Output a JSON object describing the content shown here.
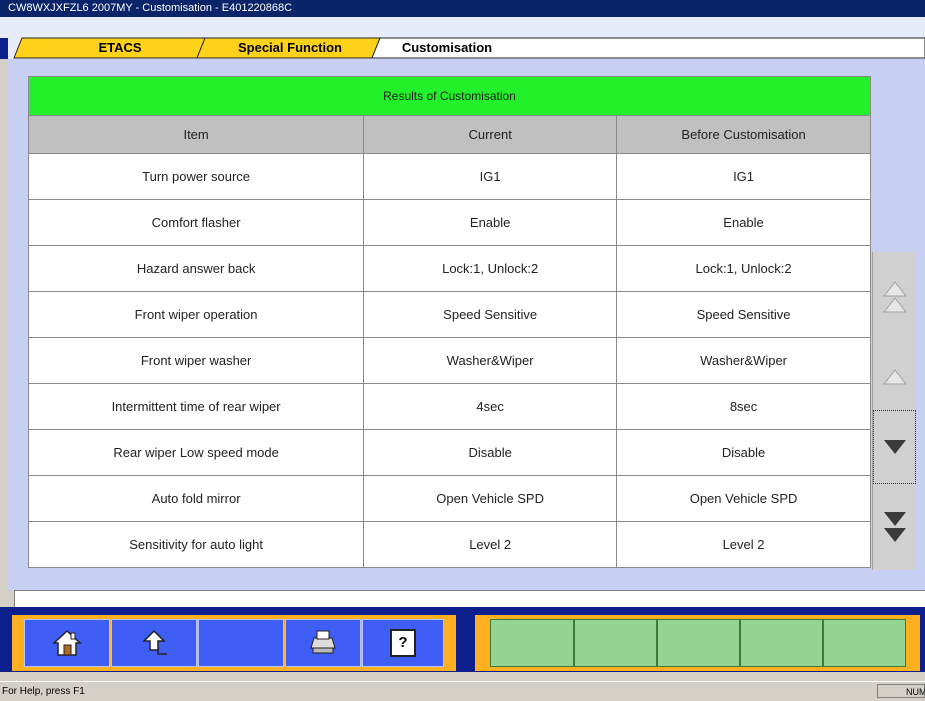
{
  "window": {
    "title": "CW8WXJXFZL6 2007MY   -  Customisation  -  E401220868C"
  },
  "tabs": [
    {
      "label": "ETACS"
    },
    {
      "label": "Special Function"
    },
    {
      "label": "Customisation"
    }
  ],
  "table": {
    "caption": "Results of Customisation",
    "columns": [
      "Item",
      "Current",
      "Before Customisation"
    ],
    "rows": [
      [
        "Turn power source",
        "IG1",
        "IG1"
      ],
      [
        "Comfort flasher",
        "Enable",
        "Enable"
      ],
      [
        "Hazard answer back",
        "Lock:1, Unlock:2",
        "Lock:1, Unlock:2"
      ],
      [
        "Front wiper operation",
        "Speed Sensitive",
        "Speed Sensitive"
      ],
      [
        "Front wiper washer",
        "Washer&Wiper",
        "Washer&Wiper"
      ],
      [
        "Intermittent time of rear wiper",
        "4sec",
        "8sec"
      ],
      [
        "Rear wiper Low speed mode",
        "Disable",
        "Disable"
      ],
      [
        "Auto fold mirror",
        "Open Vehicle SPD",
        "Open Vehicle SPD"
      ],
      [
        "Sensitivity for auto light",
        "Level 2",
        "Level 2"
      ]
    ]
  },
  "scroll_buttons": [
    "page-up-icon",
    "line-up-icon",
    "line-down-icon",
    "page-down-icon"
  ],
  "toolbar": {
    "buttons": [
      "home-icon",
      "back-icon",
      "blank",
      "printer-icon",
      "help-icon"
    ],
    "help_glyph": "?"
  },
  "status": {
    "help_text": "For Help, press F1",
    "num_indicator": "NUM"
  },
  "colors": {
    "caption_bg": "#22f02a",
    "tab_active": "#ffffff",
    "tab_inactive": "#ffd21a",
    "toolbar_blue": "#3f5ef6",
    "green_button": "#94d493"
  }
}
